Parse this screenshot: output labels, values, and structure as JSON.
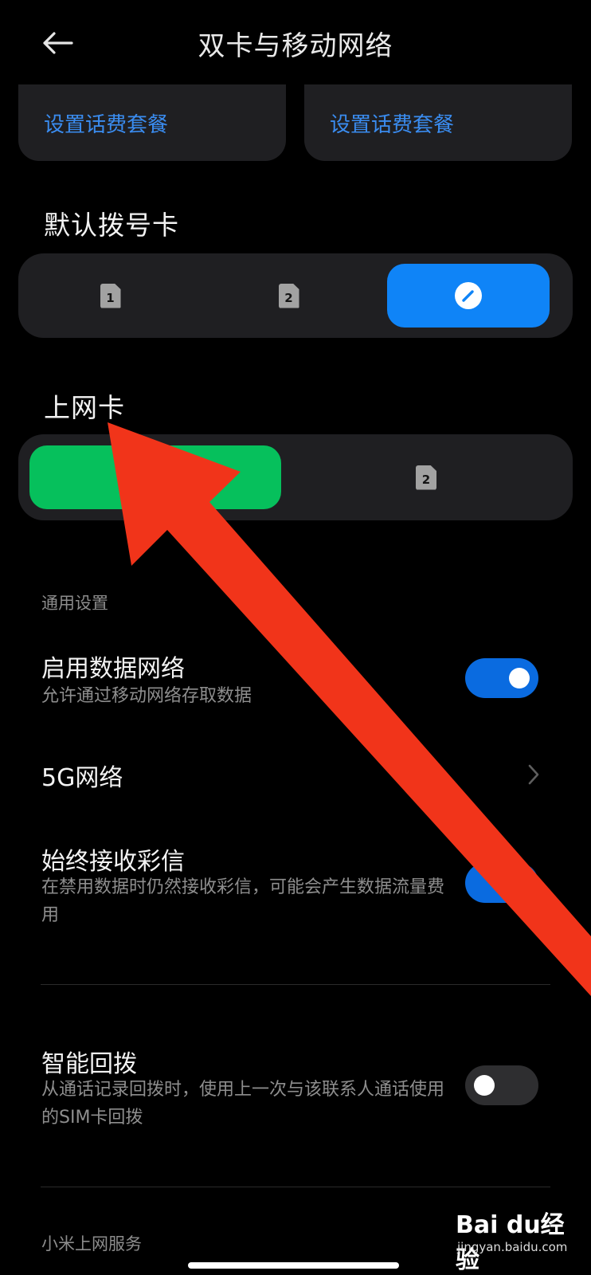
{
  "header": {
    "title": "双卡与移动网络",
    "back_icon": "arrow-left-icon"
  },
  "plans": [
    {
      "label": "设置话费套餐"
    },
    {
      "label": "设置话费套餐"
    }
  ],
  "default_dial": {
    "title": "默认拨号卡",
    "options": [
      {
        "sim": "1",
        "selected": false
      },
      {
        "sim": "2",
        "selected": false
      },
      {
        "icon": "pencil-icon",
        "selected": true
      }
    ],
    "selected_color": "#0f84f7"
  },
  "data_card": {
    "title": "上网卡",
    "options": [
      {
        "selected": true
      },
      {
        "sim": "2",
        "selected": false
      }
    ],
    "selected_color": "#06c05c"
  },
  "general": {
    "header": "通用设置",
    "items": [
      {
        "title": "启用数据网络",
        "subtitle": "允许通过移动网络存取数据",
        "toggle": "on"
      },
      {
        "title": "5G网络",
        "icon": "chevron-right-icon"
      },
      {
        "title": "始终接收彩信",
        "subtitle": "在禁用数据时仍然接收彩信，可能会产生数据流量费用",
        "toggle": "on"
      },
      {
        "title": "智能回拨",
        "subtitle": "从通话记录回拨时，使用上一次与该联系人通话使用的SIM卡回拨",
        "toggle": "off"
      }
    ]
  },
  "next_section": {
    "header": "小米上网服务"
  },
  "annotation": {
    "color": "#f1341a",
    "icon": "arrow-annotation-icon"
  },
  "watermark": {
    "brand": "Bai du经验",
    "site": "jingyan.baidu.com"
  }
}
